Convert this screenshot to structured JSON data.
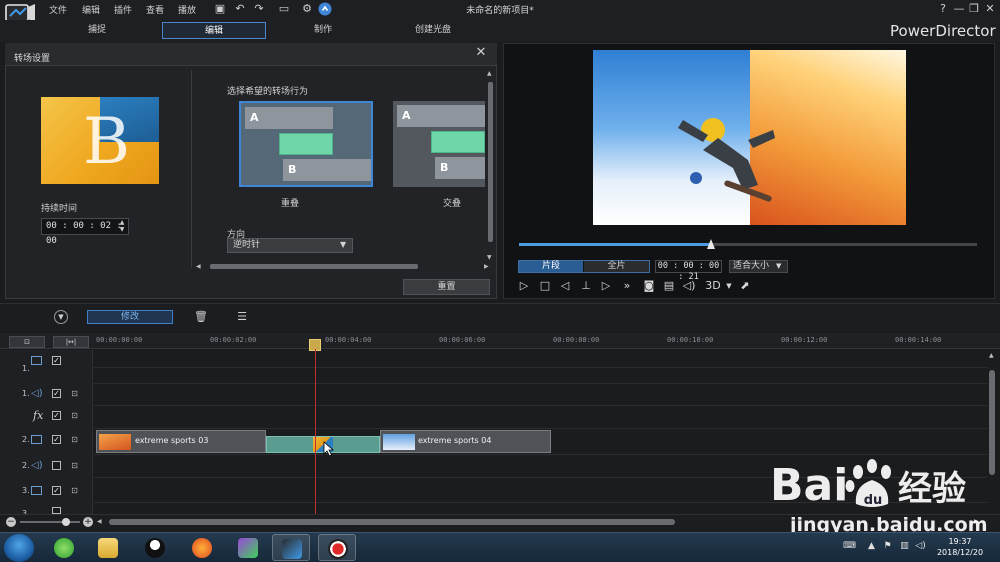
{
  "app": {
    "menu": [
      "文件",
      "编辑",
      "插件",
      "查看",
      "播放"
    ],
    "document_title": "未命名的新项目*",
    "brand": "PowerDirector",
    "mode_tabs": [
      {
        "label": "捕捉",
        "active": false
      },
      {
        "label": "编辑",
        "active": true
      },
      {
        "label": "制作",
        "active": false
      },
      {
        "label": "创建光盘",
        "active": false
      }
    ],
    "window_controls": [
      "?",
      "—",
      "❐",
      "✕"
    ]
  },
  "transition_panel": {
    "title": "转场设置",
    "duration_label": "持续时间",
    "duration_value": "00 : 00 : 02 : 00",
    "behavior_label": "选择希望的转场行为",
    "behaviors": [
      {
        "name": "重叠",
        "a": "A",
        "b": "B",
        "selected": true
      },
      {
        "name": "交叠",
        "a": "A",
        "b": "B",
        "selected": false
      }
    ],
    "direction_label": "方向",
    "direction_value": "逆时针",
    "reset_label": "重置"
  },
  "preview": {
    "progress_fraction": 0.42,
    "clip_tab": "片段",
    "full_tab": "全片",
    "timecode": "00 : 00 : 00 : 21",
    "fit_label": "适合大小",
    "mode_3d": "3D"
  },
  "timeline": {
    "modify_label": "修改",
    "ruler_ticks": [
      "00:00:00:00",
      "00:00:02:00",
      "00:00:04:00",
      "00:00:06:00",
      "00:00:08:00",
      "00:00:10:00",
      "00:00:12:00",
      "00:00:14:00"
    ],
    "tracks": [
      {
        "label": "1.",
        "kind": "video",
        "enabled": true
      },
      {
        "label": "1.",
        "kind": "audio",
        "enabled": true
      },
      {
        "label": "",
        "kind": "fx",
        "enabled": true
      },
      {
        "label": "2.",
        "kind": "video",
        "enabled": true
      },
      {
        "label": "2.",
        "kind": "audio",
        "enabled": false
      },
      {
        "label": "3.",
        "kind": "video",
        "enabled": true
      },
      {
        "label": "3.",
        "kind": "audio",
        "enabled": true
      }
    ],
    "clips": [
      {
        "name": "extreme sports 03"
      },
      {
        "name": "extreme sports 04"
      }
    ]
  },
  "taskbar": {
    "time": "19:37",
    "date": "2018/12/20"
  },
  "watermark": {
    "url": "jingyan.baidu.com"
  }
}
